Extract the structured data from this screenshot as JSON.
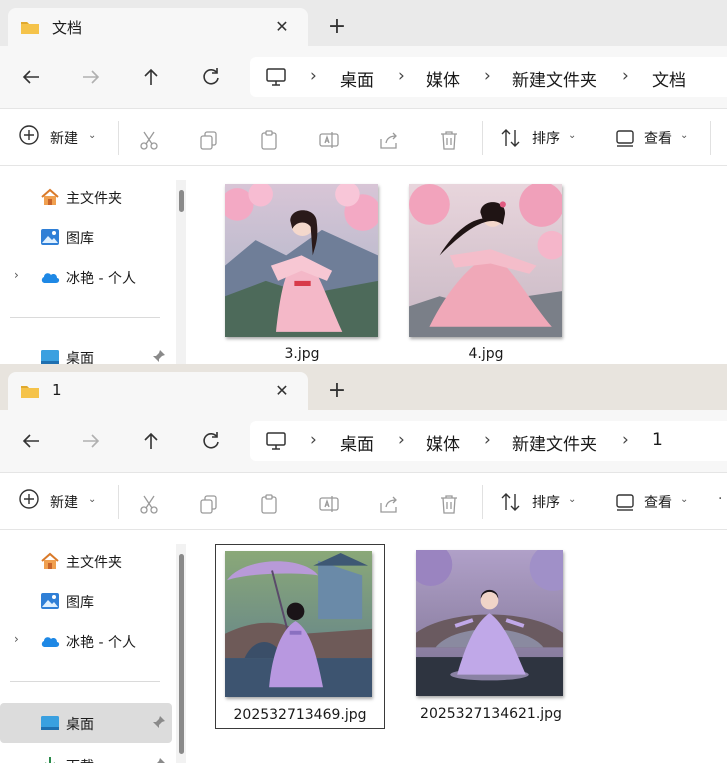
{
  "windows": [
    {
      "tab": {
        "label": "文档"
      },
      "breadcrumb": [
        "桌面",
        "媒体",
        "新建文件夹",
        "文档"
      ],
      "toolbar": {
        "new_label": "新建",
        "sort_label": "排序",
        "view_label": "查看"
      },
      "sidebar": {
        "items": [
          {
            "label": "主文件夹",
            "icon": "home-icon"
          },
          {
            "label": "图库",
            "icon": "gallery-icon"
          },
          {
            "label": "冰艳 - 个人",
            "icon": "cloud-icon"
          },
          {
            "label": "桌面",
            "icon": "desktop-icon"
          }
        ]
      },
      "files": [
        {
          "name": "3.jpg"
        },
        {
          "name": "4.jpg"
        }
      ]
    },
    {
      "tab": {
        "label": "1"
      },
      "breadcrumb": [
        "桌面",
        "媒体",
        "新建文件夹",
        "1"
      ],
      "toolbar": {
        "new_label": "新建",
        "sort_label": "排序",
        "view_label": "查看"
      },
      "sidebar": {
        "items": [
          {
            "label": "主文件夹",
            "icon": "home-icon"
          },
          {
            "label": "图库",
            "icon": "gallery-icon"
          },
          {
            "label": "冰艳 - 个人",
            "icon": "cloud-icon"
          },
          {
            "label": "桌面",
            "icon": "desktop-icon",
            "selected": true
          },
          {
            "label": "下载",
            "icon": "download-icon"
          }
        ]
      },
      "files": [
        {
          "name": "202532713469.jpg",
          "selected": true
        },
        {
          "name": "2025327134621.jpg"
        }
      ]
    }
  ],
  "colors": {
    "folder": "#f5c34a",
    "accent": "#0067c0",
    "selection": "#dcdcdc"
  }
}
